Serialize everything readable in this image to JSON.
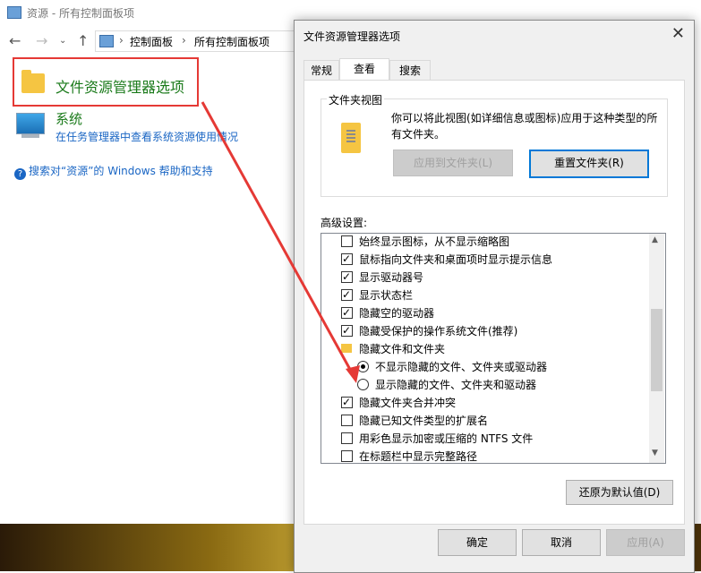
{
  "explorer": {
    "title": "资源 - 所有控制面板项",
    "breadcrumb": [
      "控制面板",
      "所有控制面板项"
    ],
    "items": [
      {
        "label": "文件资源管理器选项"
      },
      {
        "label": "系统",
        "sub": "在任务管理器中查看系统资源使用情况"
      }
    ],
    "help_link": "搜索对“资源”的 Windows 帮助和支持"
  },
  "dialog": {
    "title": "文件资源管理器选项",
    "close_glyph": "✕",
    "tabs": [
      "常规",
      "查看",
      "搜索"
    ],
    "active_tab": "查看",
    "folder_views": {
      "legend": "文件夹视图",
      "description": "你可以将此视图(如详细信息或图标)应用于这种类型的所有文件夹。",
      "apply_button": "应用到文件夹(L)",
      "reset_button": "重置文件夹(R)"
    },
    "advanced_label": "高级设置:",
    "settings": [
      {
        "type": "checkbox",
        "checked": false,
        "label": "始终显示图标，从不显示缩略图"
      },
      {
        "type": "checkbox",
        "checked": true,
        "label": "鼠标指向文件夹和桌面项时显示提示信息"
      },
      {
        "type": "checkbox",
        "checked": true,
        "label": "显示驱动器号"
      },
      {
        "type": "checkbox",
        "checked": true,
        "label": "显示状态栏"
      },
      {
        "type": "checkbox",
        "checked": true,
        "label": "隐藏空的驱动器"
      },
      {
        "type": "checkbox",
        "checked": true,
        "label": "隐藏受保护的操作系统文件(推荐)"
      },
      {
        "type": "folder",
        "label": "隐藏文件和文件夹"
      },
      {
        "type": "radio",
        "checked": true,
        "label": "不显示隐藏的文件、文件夹或驱动器"
      },
      {
        "type": "radio",
        "checked": false,
        "label": "显示隐藏的文件、文件夹和驱动器"
      },
      {
        "type": "checkbox",
        "checked": true,
        "label": "隐藏文件夹合并冲突"
      },
      {
        "type": "checkbox",
        "checked": false,
        "label": "隐藏已知文件类型的扩展名"
      },
      {
        "type": "checkbox",
        "checked": false,
        "label": "用彩色显示加密或压缩的 NTFS 文件"
      },
      {
        "type": "checkbox",
        "checked": false,
        "label": "在标题栏中显示完整路径"
      }
    ],
    "restore_button": "还原为默认值(D)",
    "ok_button": "确定",
    "cancel_button": "取消",
    "apply_button": "应用(A)"
  },
  "colors": {
    "highlight_box": "#e53935",
    "arrow": "#e53935",
    "accent": "#0078d7"
  }
}
